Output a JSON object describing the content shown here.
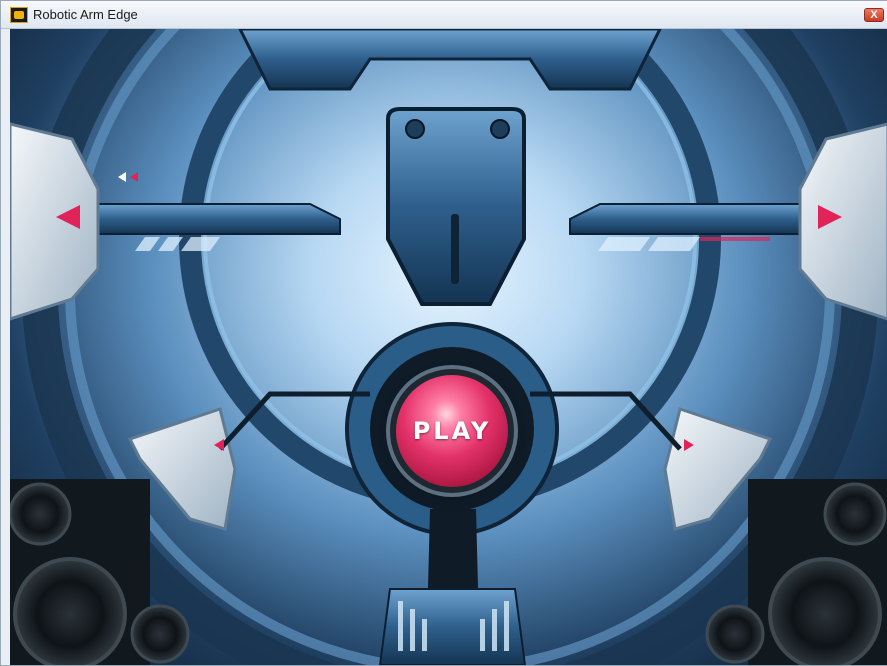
{
  "window": {
    "title": "Robotic Arm Edge",
    "close_label": "X"
  },
  "game": {
    "play_label": "PLAY",
    "accent_color": "#d7285c",
    "metal_color": "#3f78a8",
    "highlight_color": "#e9f6ff"
  },
  "icons": {
    "app": "robot-head-icon",
    "left_arrow": "triangle-left-icon",
    "right_arrow": "triangle-right-icon",
    "small_arrows": "double-arrow-left-icon"
  }
}
